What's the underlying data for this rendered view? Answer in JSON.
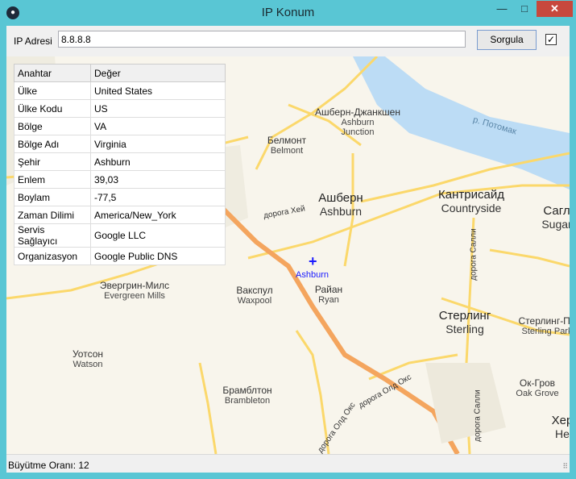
{
  "window": {
    "title": "IP Konum",
    "minimize": "—",
    "maximize": "□",
    "close": "✕",
    "app_icon": "paw-icon"
  },
  "toolbar": {
    "ip_label": "IP Adresi",
    "ip_value": "8.8.8.8",
    "query_button": "Sorgula",
    "checkbox_checked": true,
    "checkbox_mark": "✓"
  },
  "table": {
    "headers": [
      "Anahtar",
      "Değer"
    ],
    "rows": [
      {
        "key": "Ülke",
        "value": "United States"
      },
      {
        "key": "Ülke Kodu",
        "value": "US"
      },
      {
        "key": "Bölge",
        "value": "VA"
      },
      {
        "key": "Bölge Adı",
        "value": "Virginia"
      },
      {
        "key": "Şehir",
        "value": "Ashburn"
      },
      {
        "key": "Enlem",
        "value": "39,03"
      },
      {
        "key": "Boylam",
        "value": "-77,5"
      },
      {
        "key": "Zaman Dilimi",
        "value": "America/New_York"
      },
      {
        "key": "Servis Sağlayıcı",
        "value": "Google LLC"
      },
      {
        "key": "Organizasyon",
        "value": "Google Public DNS"
      }
    ]
  },
  "map": {
    "marker_symbol": "+",
    "marker_label": "Ashburn",
    "places": {
      "ashburn_junction": {
        "ru": "Ашберн-Джанкшен",
        "en1": "Ashburn",
        "en2": "Junction"
      },
      "belmont": {
        "ru": "Белмонт",
        "en": "Belmont"
      },
      "ashburn": {
        "ru": "Ашберн",
        "en": "Ashburn"
      },
      "countryside": {
        "ru": "Кантрисайд",
        "en": "Countryside"
      },
      "sugarland": {
        "ru": "Сагл",
        "en": "Sugar"
      },
      "evergreen": {
        "ru": "Эвергрин-Милс",
        "en": "Evergreen Mills"
      },
      "waxpool": {
        "ru": "Вакспул",
        "en": "Waxpool"
      },
      "ryan": {
        "ru": "Райан",
        "en": "Ryan"
      },
      "sterling": {
        "ru": "Стерлинг",
        "en": "Sterling"
      },
      "sterling_park": {
        "ru": "Стерлинг-Па",
        "en": "Sterling Park"
      },
      "watson": {
        "ru": "Уотсон",
        "en": "Watson"
      },
      "brambleton": {
        "ru": "Брамблтон",
        "en": "Brambleton"
      },
      "oak_grove": {
        "ru": "Ок-Гров",
        "en": "Oak Grove"
      },
      "herndon": {
        "ru": "Хер",
        "en": "Не"
      }
    },
    "roads": {
      "river": "р. Потомак",
      "hay": "дорога Хей",
      "sally1": "дорога Салли",
      "sally2": "дорога Салли",
      "old_ox1": "дорога Олд Окс",
      "old_ox2": "дорога Олд Окс"
    },
    "colors": {
      "land": "#f8f5ec",
      "water": "#bcdcf5",
      "highway": "#f4a55e",
      "road": "#fbd86b",
      "forest": "#ece9dc"
    }
  },
  "status": {
    "text": "Büyütme Oranı: 12",
    "grip": "⠿"
  }
}
